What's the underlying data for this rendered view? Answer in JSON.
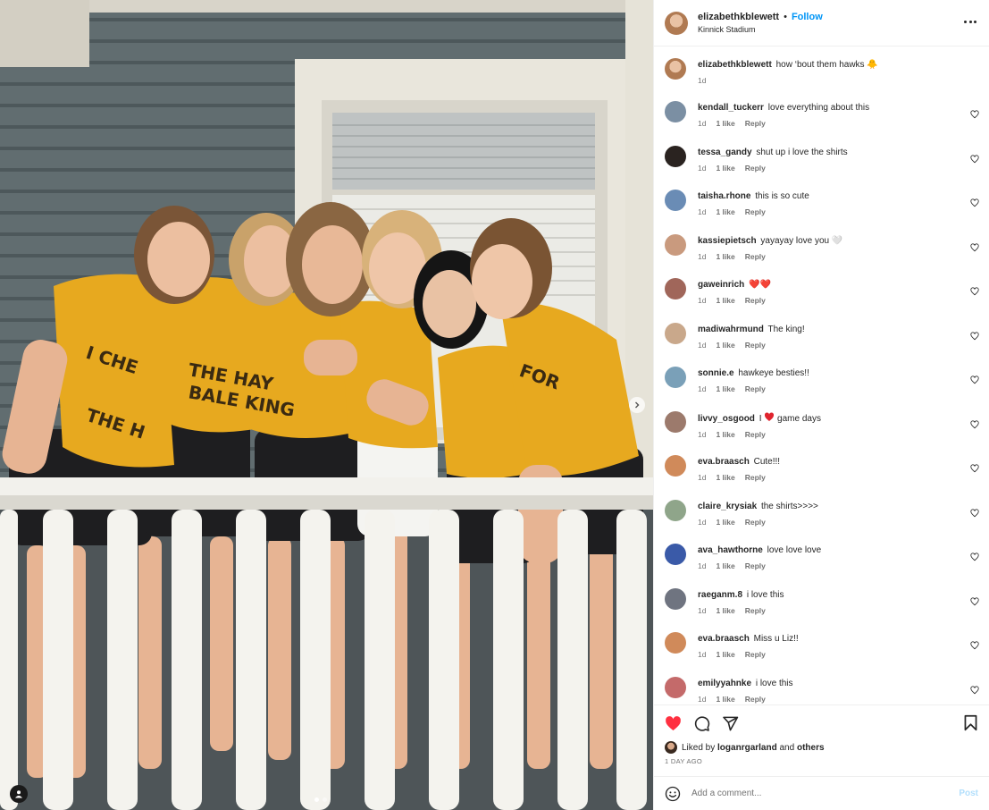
{
  "post": {
    "author": "elizabethkblewett",
    "separator": "•",
    "follow_label": "Follow",
    "location": "Kinnick Stadium",
    "caption": "how ‘bout them hawks 🐥",
    "caption_age": "1d"
  },
  "comments": [
    {
      "user": "kendall_tuckerr",
      "text": "love everything about this",
      "age": "1d",
      "likes": "1 like",
      "reply": "Reply",
      "color": "#7b8fa3"
    },
    {
      "user": "tessa_gandy",
      "text": "shut up i love the shirts",
      "age": "1d",
      "likes": "1 like",
      "reply": "Reply",
      "color": "#2a2320"
    },
    {
      "user": "taisha.rhone",
      "text": "this is so cute",
      "age": "1d",
      "likes": "1 like",
      "reply": "Reply",
      "color": "#6a8cb5"
    },
    {
      "user": "kassiepietsch",
      "text": "yayayay love you 🤍",
      "age": "1d",
      "likes": "1 like",
      "reply": "Reply",
      "color": "#c99a7e"
    },
    {
      "user": "gaweinrich",
      "text": "❤️❤️",
      "age": "1d",
      "likes": "1 like",
      "reply": "Reply",
      "color": "#a0665a"
    },
    {
      "user": "madiwahrmund",
      "text": "The king!",
      "age": "1d",
      "likes": "1 like",
      "reply": "Reply",
      "color": "#c9a88b"
    },
    {
      "user": "sonnie.e",
      "text": "hawkeye besties!!",
      "age": "1d",
      "likes": "1 like",
      "reply": "Reply",
      "color": "#7aa0b8"
    },
    {
      "user": "livvy_osgood",
      "text_pre": "I",
      "text_post": "game days",
      "age": "1d",
      "likes": "1 like",
      "reply": "Reply",
      "color": "#9c7a6c"
    },
    {
      "user": "eva.braasch",
      "text": "Cute!!!",
      "age": "1d",
      "likes": "1 like",
      "reply": "Reply",
      "color": "#d08a5a"
    },
    {
      "user": "claire_krysiak",
      "text": "the shirts>>>>",
      "age": "1d",
      "likes": "1 like",
      "reply": "Reply",
      "color": "#8fa58a"
    },
    {
      "user": "ava_hawthorne",
      "text": "love love love",
      "age": "1d",
      "likes": "1 like",
      "reply": "Reply",
      "color": "#3a5aa8"
    },
    {
      "user": "raeganm.8",
      "text": "i love this",
      "age": "1d",
      "likes": "1 like",
      "reply": "Reply",
      "color": "#6f7480"
    },
    {
      "user": "eva.braasch",
      "text": "Miss u Liz!!",
      "age": "1d",
      "likes": "1 like",
      "reply": "Reply",
      "color": "#d08a5a"
    },
    {
      "user": "emilyyahnke",
      "text": "i love this",
      "age": "1d",
      "likes": "1 like",
      "reply": "Reply",
      "color": "#c46a6a"
    }
  ],
  "likes": {
    "prefix": "Liked by",
    "user": "loganrgarland",
    "and": "and",
    "others": "others",
    "when": "1 DAY AGO"
  },
  "add_comment": {
    "placeholder": "Add a comment...",
    "post_label": "Post"
  },
  "colors": {
    "accent": "#0095f6",
    "like_red": "#ff3040",
    "shirt_gold": "#e7a91f"
  },
  "icons": [
    "heart-icon",
    "comment-icon",
    "share-icon",
    "bookmark-icon",
    "emoji-icon",
    "more-icon",
    "chevron-right-icon",
    "user-tag-icon"
  ]
}
